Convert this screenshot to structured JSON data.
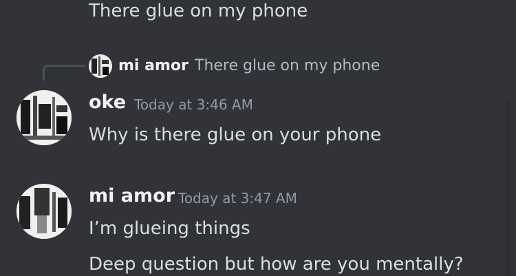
{
  "messages": {
    "prev_line": "There glue on my phone",
    "reply": {
      "author": "mi amor",
      "text": "There glue on my phone"
    },
    "msg1": {
      "author": "oke",
      "timestamp": "Today at 3:46 AM",
      "text": "Why is there glue on your phone"
    },
    "msg2": {
      "author": "mi amor",
      "timestamp": "Today at 3:47 AM",
      "text": "I’m glueing things",
      "text2": "Deep question but how are you mentally?"
    }
  },
  "colors": {
    "background": "#313338",
    "text": "#dbdee1",
    "username": "#f2f3f5",
    "timestamp": "#949ba4"
  }
}
